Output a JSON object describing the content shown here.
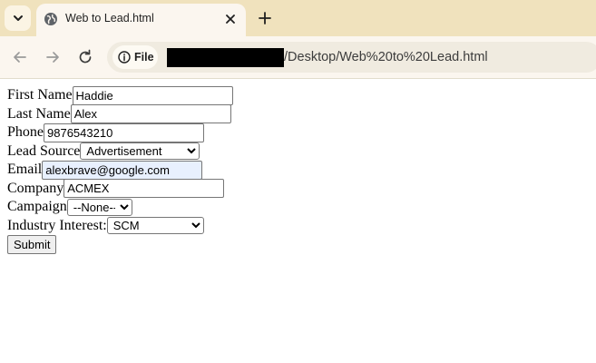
{
  "browser": {
    "tab_title": "Web to Lead.html",
    "site_chip_label": "File",
    "url_path": "/Desktop/Web%20to%20Lead.html"
  },
  "form": {
    "first_name_label": "First Name",
    "first_name_value": "Haddie",
    "last_name_label": "Last Name",
    "last_name_value": "Alex",
    "phone_label": "Phone",
    "phone_value": "9876543210",
    "lead_source_label": "Lead Source",
    "lead_source_value": "Advertisement",
    "email_label": "Email",
    "email_value": "alexbrave@google.com",
    "company_label": "Company",
    "company_value": "ACMEX",
    "campaign_label": "Campaign",
    "campaign_value": "--None--",
    "industry_label": "Industry Interest:",
    "industry_value": "SCM",
    "submit_label": "Submit"
  },
  "colors": {
    "tabstrip_bg": "#f0e2bd",
    "toolbar_bg": "#fbf6ef",
    "autofill_bg": "#e8f0fe"
  },
  "icons": [
    "tab-search-icon",
    "globe-icon",
    "close-icon",
    "plus-icon",
    "back-icon",
    "forward-icon",
    "reload-icon",
    "info-icon"
  ]
}
